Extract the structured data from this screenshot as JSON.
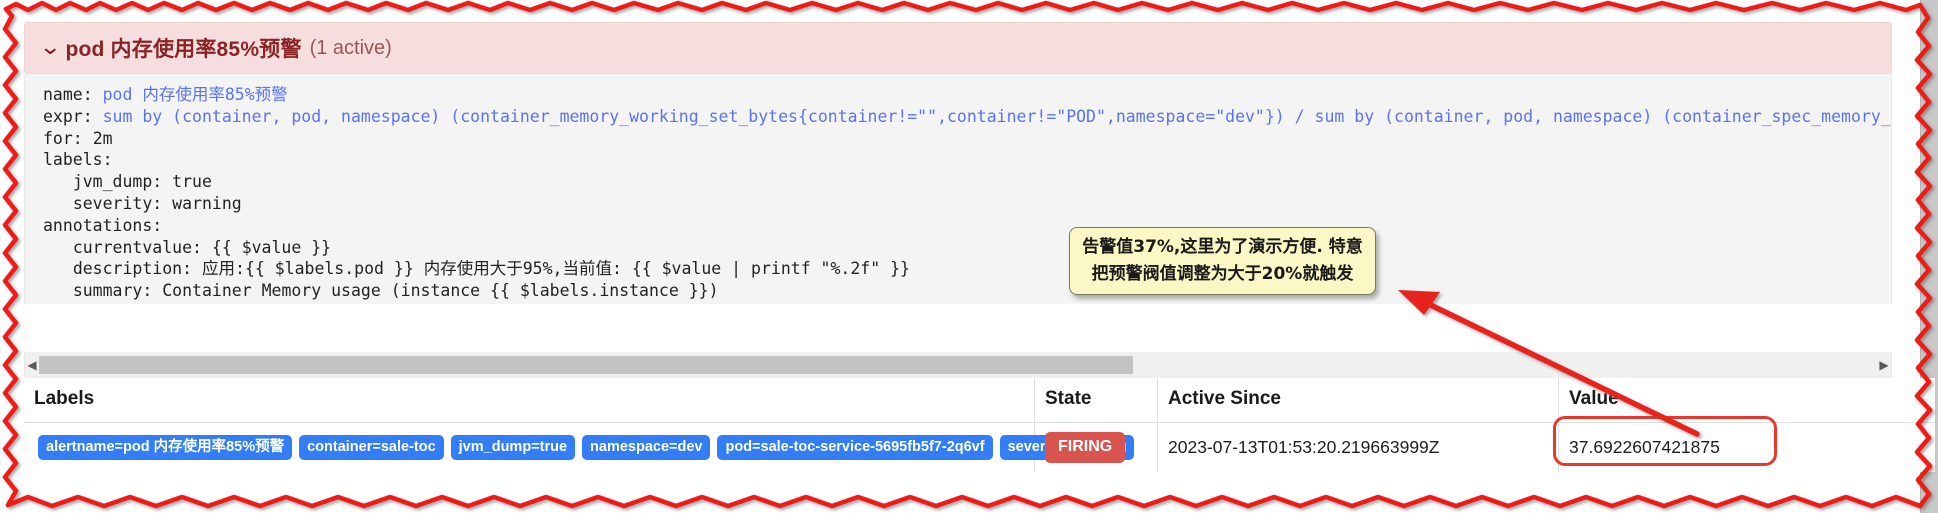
{
  "alert": {
    "collapse_icon": "chevron-down-icon",
    "title": "pod 内存使用率85%预警",
    "active_count": "(1 active)"
  },
  "rule_yaml": {
    "name_key": "name:",
    "name_value": "pod 内存使用率85%预警",
    "expr_key": "expr:",
    "expr_value": "sum by (container, pod, namespace) (container_memory_working_set_bytes{container!=\"\",container!=\"POD\",namespace=\"dev\"}) / sum by (container, pod, namespace) (container_spec_memory_limit_by",
    "for_key": "for:",
    "for_value": "2m",
    "labels_key": "labels:",
    "labels": [
      {
        "key": "jvm_dump:",
        "value": "true"
      },
      {
        "key": "severity:",
        "value": "warning"
      }
    ],
    "annotations_key": "annotations:",
    "annotations": [
      {
        "key": "currentvalue:",
        "value": "{{ $value }}"
      },
      {
        "key": "description:",
        "value": "应用:{{ $labels.pod }} 内存使用大于95%,当前值: {{ $value | printf \"%.2f\" }}"
      },
      {
        "key": "summary:",
        "value": "Container Memory usage (instance {{ $labels.instance }})"
      }
    ]
  },
  "scrollbar": {
    "left_arrow": "◀",
    "right_arrow": "▶",
    "thumb_percent": 59.5
  },
  "table": {
    "headers": [
      "Labels",
      "State",
      "Active Since",
      "Value"
    ],
    "rows": [
      {
        "labels": [
          "alertname=pod 内存使用率85%预警",
          "container=sale-toc",
          "jvm_dump=true",
          "namespace=dev",
          "pod=sale-toc-service-5695fb5f7-2q6vf",
          "severity=warning"
        ],
        "state": "FIRING",
        "active_since": "2023-07-13T01:53:20.219663999Z",
        "value": "37.6922607421875"
      }
    ]
  },
  "annotation_note": {
    "text": "告警值37%,这里为了演示方便. 特意\n把预警阀值调整为大于20%就触发"
  },
  "colors": {
    "alert_header_bg": "#f6dede",
    "alert_header_text": "#8a2424",
    "badge_blue": "#337ef7",
    "state_red": "#d9534f",
    "annotation_red": "#e8392c",
    "note_yellow": "#fcf8c6",
    "expr_blue": "#5a73f0"
  }
}
